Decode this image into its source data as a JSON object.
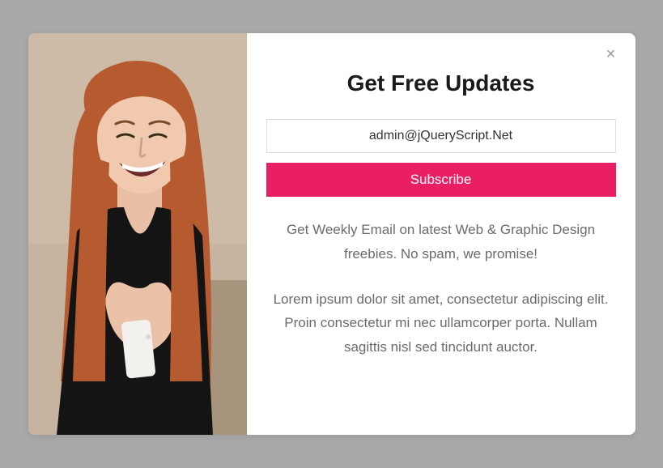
{
  "modal": {
    "title": "Get Free Updates",
    "email_placeholder": "admin@jQueryScript.Net",
    "subscribe_label": "Subscribe",
    "description": "Get Weekly Email on latest Web & Graphic Design freebies. No spam, we promise!",
    "subdescription": "Lorem ipsum dolor sit amet, consectetur adipiscing elit. Proin consectetur mi nec ullamcorper porta. Nullam sagittis nisl sed tincidunt auctor.",
    "close_glyph": "×",
    "image_alt": "person-illustration"
  },
  "colors": {
    "accent": "#e91e63",
    "background": "#a9a9a9"
  }
}
